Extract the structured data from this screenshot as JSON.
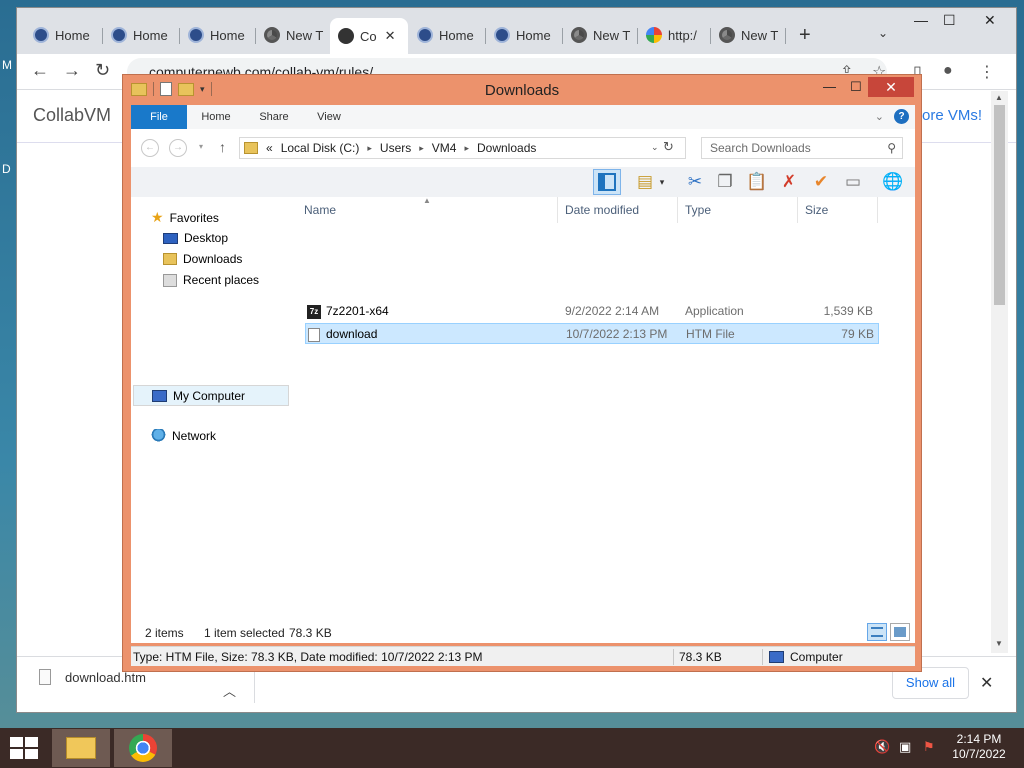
{
  "desktop": {
    "left_fragments": [
      "M",
      "D"
    ]
  },
  "browser": {
    "tabs": [
      {
        "label": "Home",
        "icon": "collabvm-favicon"
      },
      {
        "label": "Home",
        "icon": "collabvm-favicon"
      },
      {
        "label": "Home",
        "icon": "collabvm-favicon"
      },
      {
        "label": "New T",
        "icon": "chrome-favicon"
      },
      {
        "label": "Co",
        "icon": "shield-favicon",
        "active": true
      },
      {
        "label": "Home",
        "icon": "collabvm-favicon"
      },
      {
        "label": "Home",
        "icon": "collabvm-favicon"
      },
      {
        "label": "New T",
        "icon": "chrome-favicon"
      },
      {
        "label": "http:/",
        "icon": "google-favicon"
      },
      {
        "label": "New T",
        "icon": "chrome-favicon"
      }
    ],
    "url": "computernewb.com/collab-vm/rules/",
    "site_title": "CollabVM",
    "site_link_fragment": "ore VMs!",
    "download": {
      "filename": "download.htm",
      "show_all_label": "Show all"
    }
  },
  "explorer": {
    "title": "Downloads",
    "ribbon_tabs": [
      "File",
      "Home",
      "Share",
      "View"
    ],
    "breadcrumb": [
      "Local Disk (C:)",
      "Users",
      "VM4",
      "Downloads"
    ],
    "breadcrumb_prefix": "«",
    "search_placeholder": "Search Downloads",
    "nav": {
      "favorites": "Favorites",
      "desktop": "Desktop",
      "downloads": "Downloads",
      "recent": "Recent places",
      "computer": "My Computer",
      "network": "Network"
    },
    "columns": [
      "Name",
      "Date modified",
      "Type",
      "Size"
    ],
    "files": [
      {
        "name": "7z2201-x64",
        "date": "9/2/2022 2:14 AM",
        "type": "Application",
        "size": "1,539 KB"
      },
      {
        "name": "download",
        "date": "10/7/2022 2:13 PM",
        "type": "HTM File",
        "size": "79 KB",
        "selected": true
      }
    ],
    "status": {
      "item_count": "2 items",
      "selected": "1 item selected",
      "selected_size": "78.3 KB",
      "details": "Type: HTM File, Size: 78.3 KB, Date modified: 10/7/2022 2:13 PM",
      "details_size": "78.3 KB",
      "location": "Computer"
    }
  },
  "taskbar": {
    "time": "2:14 PM",
    "date": "10/7/2022"
  },
  "colors": {
    "explorer_frame": "#ec926c",
    "file_tab": "#1979ca",
    "selection": "#cce8ff",
    "taskbar": "#3b2a26"
  }
}
